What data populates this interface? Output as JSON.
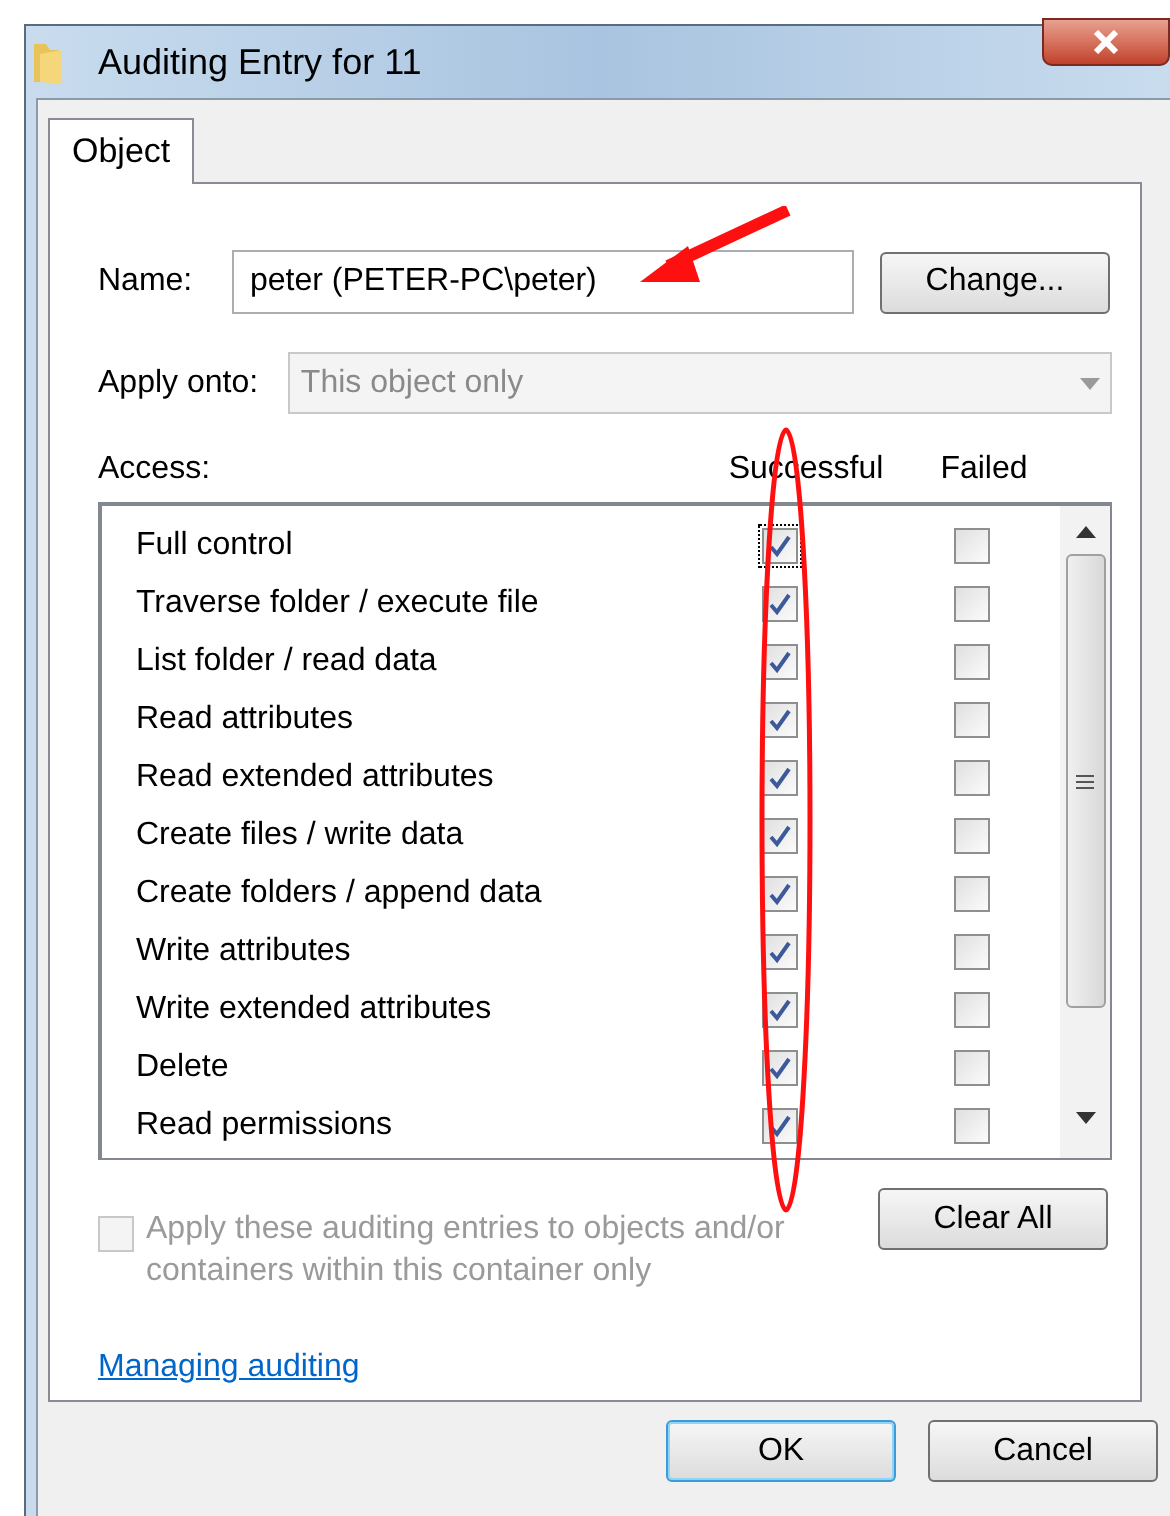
{
  "window": {
    "title": "Auditing Entry for 11"
  },
  "tabs": [
    {
      "label": "Object",
      "selected": true
    }
  ],
  "name_field": {
    "label": "Name:",
    "value": "peter (PETER-PC\\peter)"
  },
  "change_button": "Change...",
  "apply_onto": {
    "label": "Apply onto:",
    "value": "This object only",
    "disabled": true
  },
  "access": {
    "label": "Access:",
    "columns": [
      "Successful",
      "Failed"
    ],
    "rows": [
      {
        "name": "Full control",
        "successful": true,
        "failed": false
      },
      {
        "name": "Traverse folder / execute file",
        "successful": true,
        "failed": false
      },
      {
        "name": "List folder / read data",
        "successful": true,
        "failed": false
      },
      {
        "name": "Read attributes",
        "successful": true,
        "failed": false
      },
      {
        "name": "Read extended attributes",
        "successful": true,
        "failed": false
      },
      {
        "name": "Create files / write data",
        "successful": true,
        "failed": false
      },
      {
        "name": "Create folders / append data",
        "successful": true,
        "failed": false
      },
      {
        "name": "Write attributes",
        "successful": true,
        "failed": false
      },
      {
        "name": "Write extended attributes",
        "successful": true,
        "failed": false
      },
      {
        "name": "Delete",
        "successful": true,
        "failed": false
      },
      {
        "name": "Read permissions",
        "successful": true,
        "failed": false
      }
    ]
  },
  "apply_checkbox": {
    "label": "Apply these auditing entries to objects and/or containers within this container only",
    "checked": false,
    "disabled": true
  },
  "clear_all_button": "Clear All",
  "link": "Managing auditing",
  "buttons": [
    {
      "label": "OK",
      "default": true
    },
    {
      "label": "Cancel",
      "default": false
    }
  ]
}
